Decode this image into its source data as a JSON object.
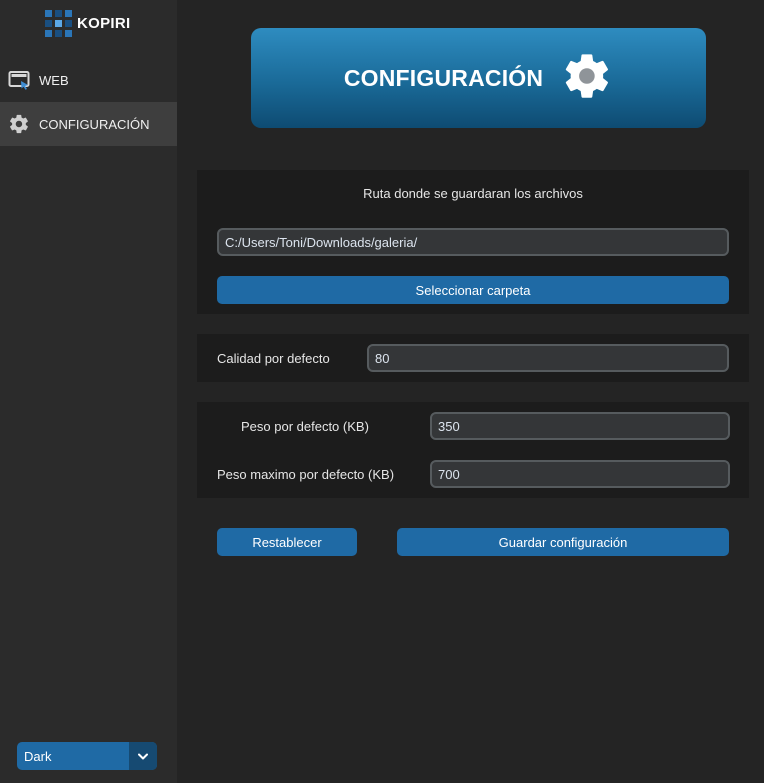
{
  "app": {
    "name": "KOPIRI",
    "accent_color": "#1f6aa5"
  },
  "sidebar": {
    "items": [
      {
        "label": "WEB",
        "icon": "monitor-icon",
        "active": false
      },
      {
        "label": "CONFIGURACIÓN",
        "icon": "gear-icon",
        "active": true
      }
    ],
    "theme_select": {
      "value": "Dark",
      "icon": "chevron-down-icon"
    }
  },
  "header": {
    "title": "CONFIGURACIÓN",
    "icon": "gear-icon"
  },
  "route_section": {
    "label": "Ruta donde se guardaran los archivos",
    "path_value": "C:/Users/Toni/Downloads/galeria/",
    "select_button": "Seleccionar carpeta"
  },
  "quality_section": {
    "label": "Calidad por defecto",
    "value": "80"
  },
  "weight_section": {
    "default_label": "Peso por defecto (KB)",
    "default_value": "350",
    "max_label": "Peso maximo por defecto (KB)",
    "max_value": "700"
  },
  "actions": {
    "reset_button": "Restablecer",
    "save_button": "Guardar configuración"
  }
}
